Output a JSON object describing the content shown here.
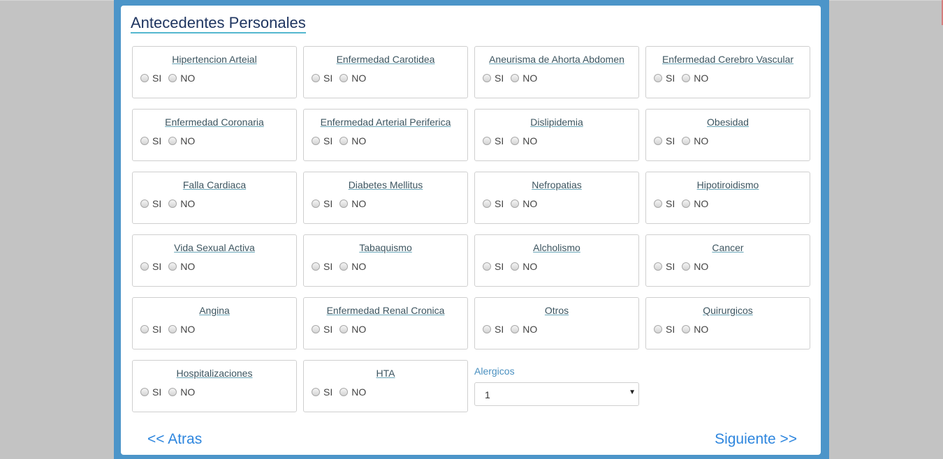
{
  "title": "Antecedentes Personales",
  "options": {
    "yes": "SI",
    "no": "NO"
  },
  "items": [
    "Hipertencion Arteial",
    "Enfermedad Carotidea",
    "Aneurisma de Ahorta Abdomen",
    "Enfermedad Cerebro Vascular",
    "Enfermedad Coronaria",
    "Enfermedad Arterial Periferica",
    "Dislipidemia",
    "Obesidad",
    "Falla Cardiaca",
    "Diabetes Mellitus",
    "Nefropatias",
    "Hipotiroidismo",
    "Vida Sexual Activa",
    "Tabaquismo",
    "Alcholismo",
    "Cancer",
    "Angina",
    "Enfermedad Renal Cronica",
    "Otros",
    "Quirurgicos",
    "Hospitalizaciones",
    "HTA"
  ],
  "alergicos": {
    "label": "Alergicos",
    "value": "1"
  },
  "nav": {
    "back": "<< Atras",
    "next": "Siguiente >>"
  },
  "colors": {
    "frame": "#4c95c9",
    "link": "#2e86de",
    "title": "#1f3560"
  }
}
